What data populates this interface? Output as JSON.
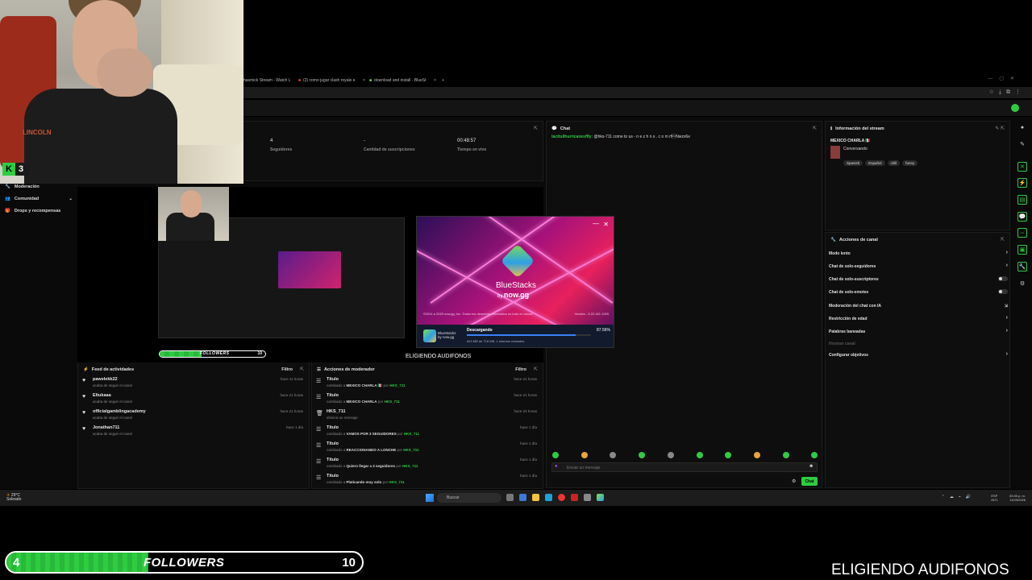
{
  "browser": {
    "tabs": [
      {
        "label": "hasmick Stream - Watch L"
      },
      {
        "label": "(2) como jugar clash royale e"
      },
      {
        "label": "download and install - BlueSt"
      }
    ],
    "new_tab": "+"
  },
  "webcam": {
    "shirt_text": "LINCOLN",
    "badge_letter": "K",
    "badge_count": "3"
  },
  "stats": {
    "followers_value": "4",
    "followers_label": "Seguidores",
    "subs_value": "-",
    "subs_label": "Cantidad de suscripciones",
    "live_value": "00:48:57",
    "live_label": "Tiempo en vivo"
  },
  "left_nav": {
    "items": [
      {
        "label": "Moderación"
      },
      {
        "label": "Comunidad"
      },
      {
        "label": "Drops y recompensas"
      }
    ]
  },
  "preview": {
    "caption": "ELIGIENDO AUDIFONOS",
    "mini_follow_label": "FOLLOWERS",
    "mini_follow_goal": "10"
  },
  "bluestacks": {
    "brand": "BlueStacks",
    "by": "by",
    "by_brand": "now.gg",
    "copyright": "©2011 a 2025 now.gg, Inc. Todos los derechos reservados en todo el mundo",
    "version": "Versión - 5.22.161.1005",
    "bar_label_1": "BlueStacks",
    "bar_label_2": "by now.gg",
    "status": "Descargando",
    "percent": "87.56%",
    "progress": 0.8756,
    "size": "629 MB de 718 MB, 1 minutos restantes"
  },
  "activity_feed": {
    "title": "Feed de actividades",
    "filter": "Filtro",
    "items": [
      {
        "name": "pawelekk22",
        "sub": "acaba de seguir el canal",
        "time": "hace 11 horas"
      },
      {
        "name": "Eltukaaa",
        "sub": "acaba de seguir el canal",
        "time": "hace 21 horas"
      },
      {
        "name": "officialgamblingacademy",
        "sub": "acaba de seguir el canal",
        "time": "hace 21 horas"
      },
      {
        "name": "Jonathan711",
        "sub": "acaba de seguir el canal",
        "time": "hace 1 día"
      }
    ]
  },
  "mod_actions": {
    "title": "Acciones de moderador",
    "filter": "Filtro",
    "items": [
      {
        "name": "Título",
        "pre": "cambiado a",
        "value": "MEXICO CHARLA 🇲🇽",
        "by": "por",
        "user": "HKS_711",
        "time": "hace 21 horas"
      },
      {
        "name": "Título",
        "pre": "cambiado a",
        "value": "MEXICO CHARLA",
        "by": "por",
        "user": "HKS_711",
        "time": "hace 21 horas"
      },
      {
        "name": "HKS_711",
        "pre": "eliminó un mensaje",
        "value": "",
        "by": "",
        "user": "",
        "time": "hace 23 horas"
      },
      {
        "name": "Título",
        "pre": "cambiado a",
        "value": "VAMOS POR 3 SEGUIDORES",
        "by": "por",
        "user": "HKS_711",
        "time": "hace 1 día"
      },
      {
        "name": "Título",
        "pre": "cambiado a",
        "value": "REACCIONANDO A LONCHE",
        "by": "por",
        "user": "HKS_711",
        "time": "hace 1 día"
      },
      {
        "name": "Título",
        "pre": "cambiado a",
        "value": "Quiero llegar a 3 seguidores",
        "by": "por",
        "user": "HKS_711",
        "time": "hace 1 día"
      },
      {
        "name": "Título",
        "pre": "cambiado a",
        "value": "Platicando muy solo",
        "by": "por",
        "user": "HKS_711",
        "time": "hace 1 día"
      }
    ]
  },
  "chat": {
    "title": "Chat",
    "message_user": "tacttuilhurricanesffly:",
    "message_text": "@hks-711 come to us - n e z h n s . c o m rf\u0003Nwzx6e",
    "placeholder": "Enviar un mensaje",
    "send_label": "Chat"
  },
  "stream_info": {
    "title": "Información del stream",
    "stream_title": "MEXICO CHARLA 🇲🇽",
    "category": "Conversando",
    "tags": [
      "Spanish",
      "Español",
      "chill",
      "funny"
    ]
  },
  "channel_actions": {
    "title": "Acciones de canal",
    "rows": [
      {
        "label": "Modo lento",
        "control": "chevron"
      },
      {
        "label": "Chat de solo-seguidores",
        "control": "chevron"
      },
      {
        "label": "Chat de solo-suscriptores",
        "control": "toggle"
      },
      {
        "label": "Chat de solo-emotes",
        "control": "toggle"
      },
      {
        "label": "Moderación del chat con IA",
        "control": "link"
      },
      {
        "label": "Restricción de edad",
        "control": "chevron"
      },
      {
        "label": "Palabras baneadas",
        "control": "chevron"
      },
      {
        "label": "Hostear canal",
        "control": "none"
      },
      {
        "label": "Configurar objetivos",
        "control": "chevron"
      }
    ]
  },
  "taskbar": {
    "weather_temp": "29°C",
    "weather_desc": "Soleado",
    "search": "Buscar",
    "lang_1": "ESP",
    "lang_2": "INTL",
    "time": "03:30 p. m.",
    "date": "11/03/2026"
  },
  "overlay": {
    "followers_current": "4",
    "followers_label": "FOLLOWERS",
    "followers_goal": "10",
    "progress": 0.4,
    "caption": "ELIGIENDO AUDIFONOS"
  },
  "colors": {
    "accent": "#2ecc40",
    "background": "#0a0a0a",
    "panel": "#0e0e0e"
  }
}
